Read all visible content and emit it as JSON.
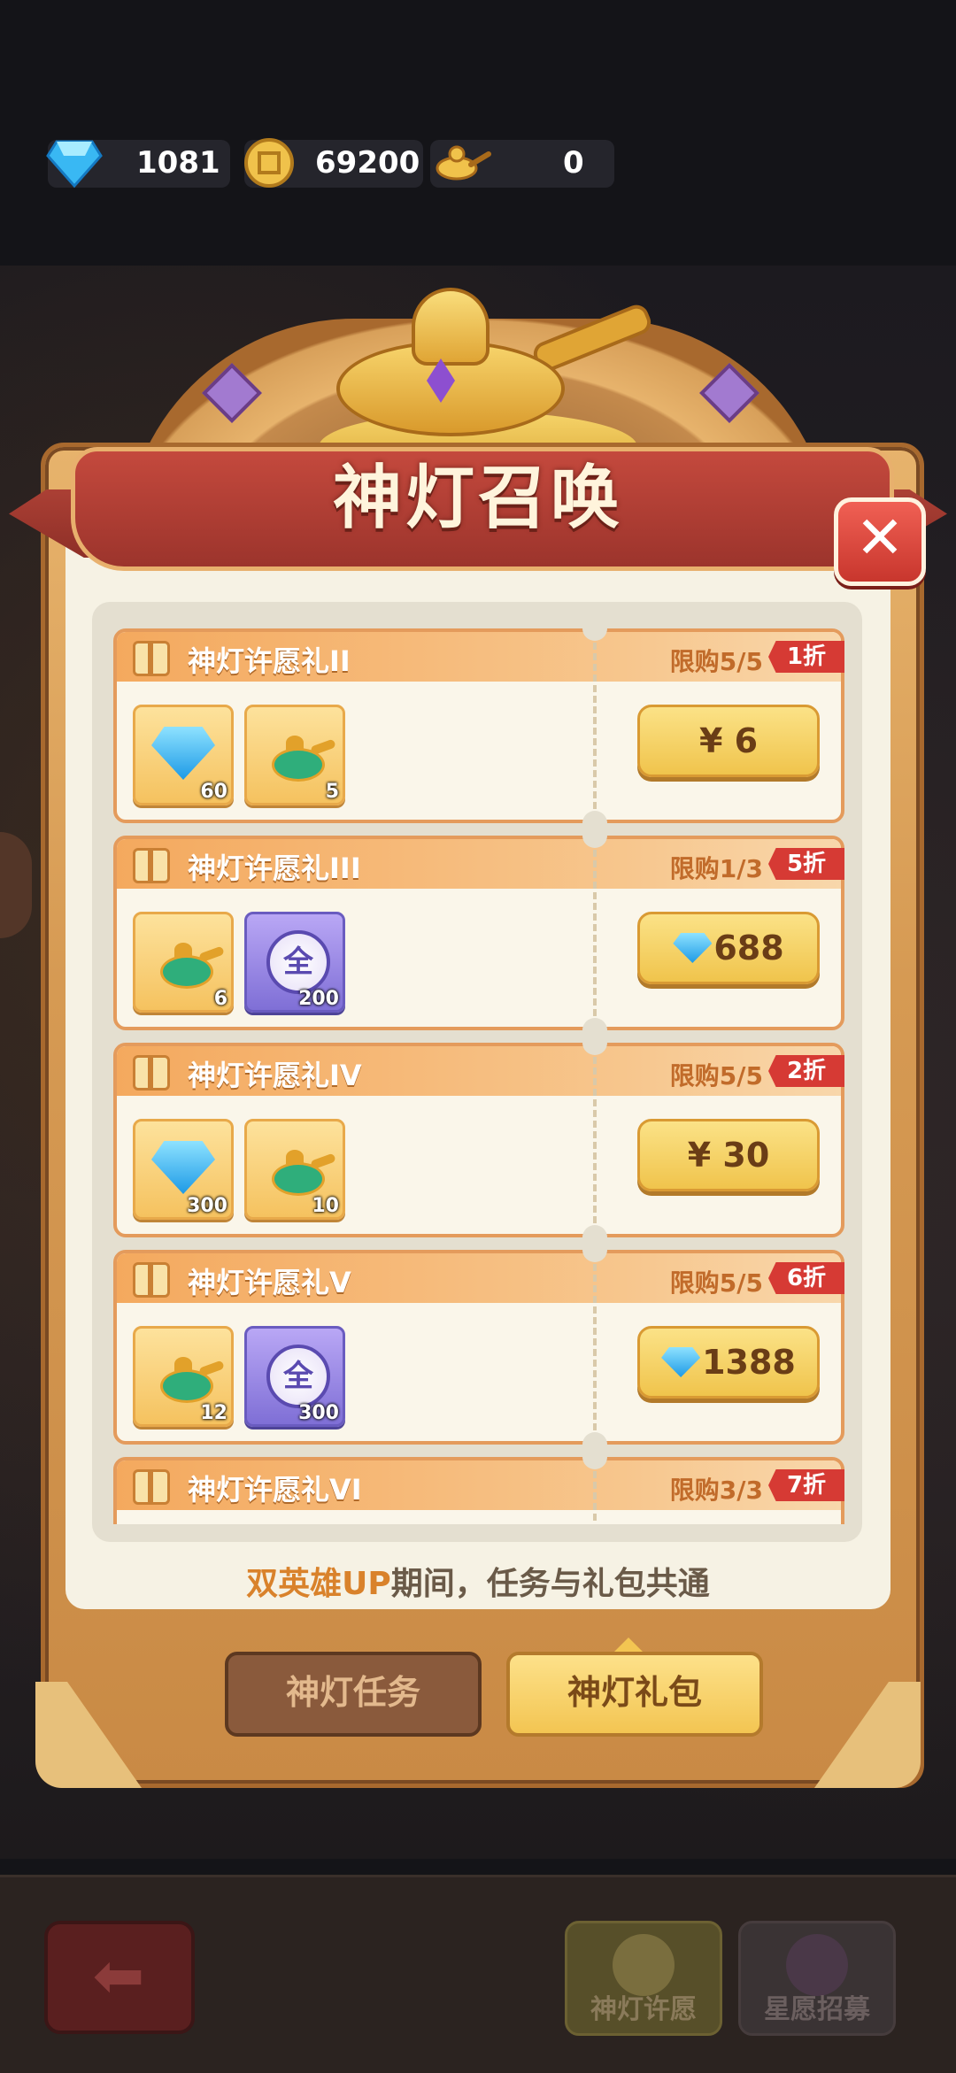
{
  "currency": {
    "diamonds": "1081",
    "coins": "69200",
    "lamps": "0",
    "diamond_icon": "diamond-icon",
    "coin_icon": "coin-icon",
    "lamp_icon": "magic-lamp-icon"
  },
  "modal": {
    "title": "神灯召唤",
    "close_icon": "close-icon"
  },
  "packs": [
    {
      "title": "神灯许愿礼II",
      "limit": "限购5/5",
      "discount": "1折",
      "items": [
        {
          "icon": "diamond-icon",
          "qty": "60"
        },
        {
          "icon": "magic-lamp-icon",
          "qty": "5"
        }
      ],
      "price": "¥ 6",
      "price_gem": false
    },
    {
      "title": "神灯许愿礼III",
      "limit": "限购1/3",
      "discount": "5折",
      "items": [
        {
          "icon": "magic-lamp-icon",
          "qty": "6"
        },
        {
          "icon": "all-hero-orb-icon",
          "qty": "200",
          "glyph": "全"
        }
      ],
      "price": "688",
      "price_gem": true
    },
    {
      "title": "神灯许愿礼IV",
      "limit": "限购5/5",
      "discount": "2折",
      "items": [
        {
          "icon": "diamond-icon",
          "qty": "300"
        },
        {
          "icon": "magic-lamp-icon",
          "qty": "10"
        }
      ],
      "price": "¥ 30",
      "price_gem": false
    },
    {
      "title": "神灯许愿礼V",
      "limit": "限购5/5",
      "discount": "6折",
      "items": [
        {
          "icon": "magic-lamp-icon",
          "qty": "12"
        },
        {
          "icon": "all-hero-orb-icon",
          "qty": "300",
          "glyph": "全"
        }
      ],
      "price": "1388",
      "price_gem": true
    },
    {
      "title": "神灯许愿礼VI",
      "limit": "限购3/3",
      "discount": "7折",
      "items": [],
      "price": "",
      "price_gem": false
    }
  ],
  "footer": {
    "highlight": "双英雄UP",
    "rest": "期间，任务与礼包共通"
  },
  "tabs": {
    "task": "神灯任务",
    "gift": "神灯礼包"
  },
  "bottom_nav": {
    "wish": "神灯许愿",
    "recruit": "星愿招募"
  },
  "colors": {
    "accent_gold": "#f3c552",
    "banner_red": "#b8473b",
    "discount_red": "#d63a34"
  }
}
